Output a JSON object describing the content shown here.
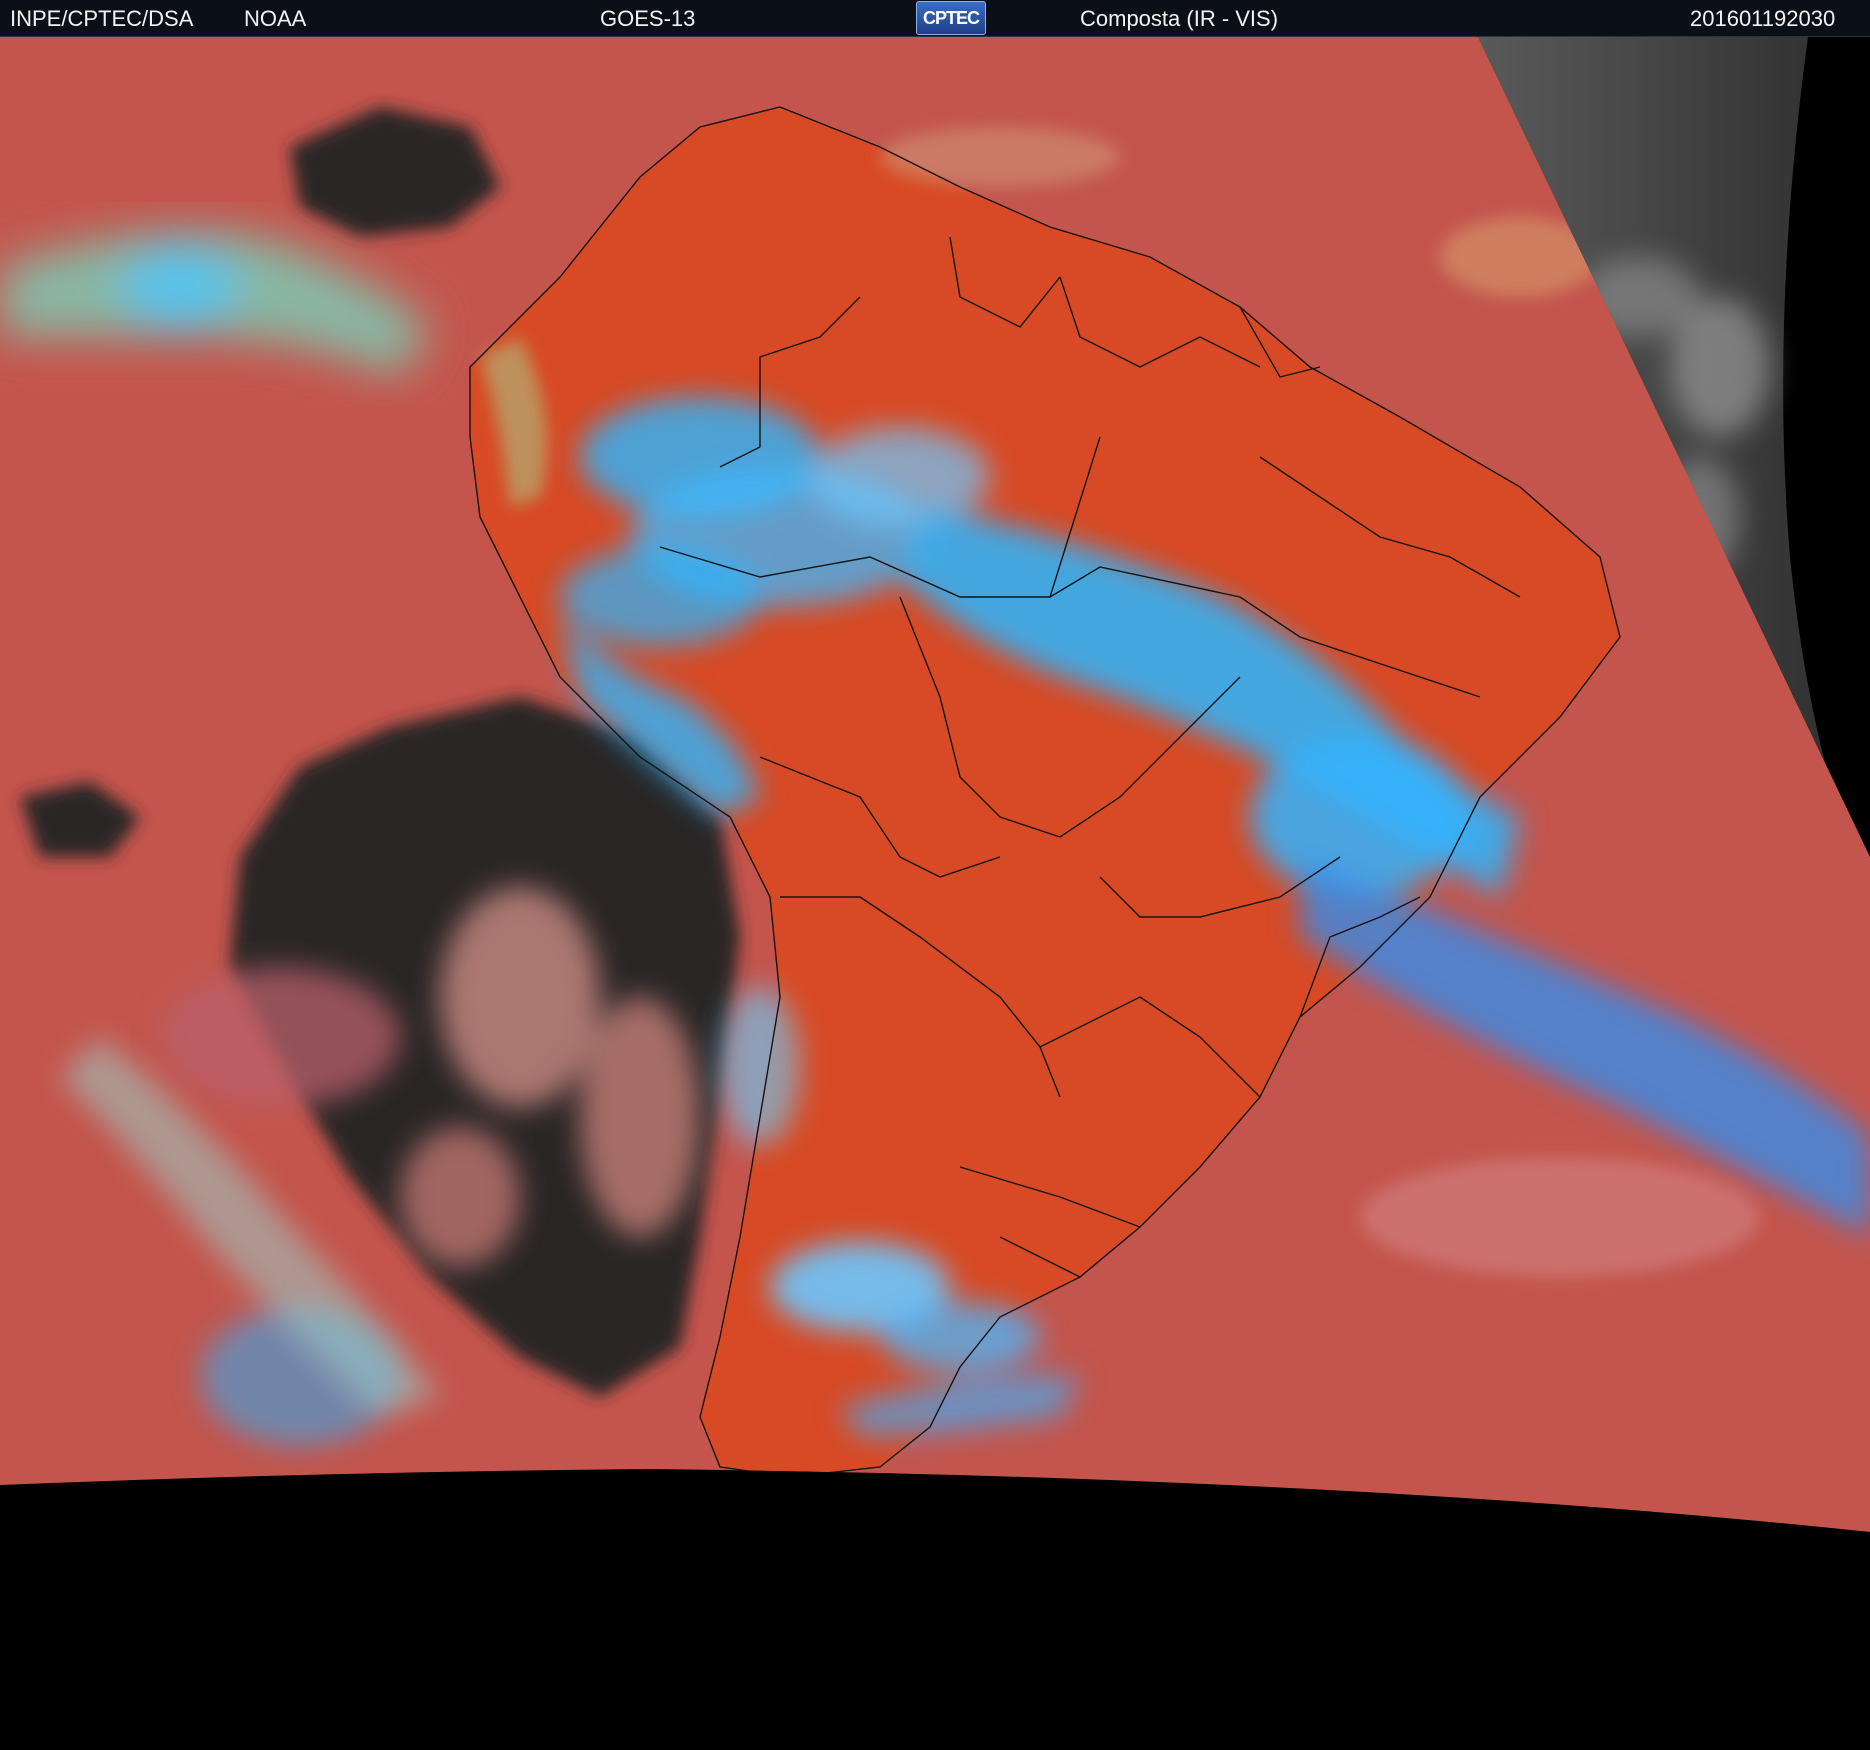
{
  "header": {
    "agency": "INPE/CPTEC/DSA",
    "source": "NOAA",
    "satellite": "GOES-13",
    "logo_text": "CPTEC",
    "product": "Composta (IR - VIS)",
    "timestamp": "201601192030"
  },
  "colors": {
    "background": "#000000",
    "clear_sky": "#c9544a",
    "land_clear": "#e0461f",
    "high_cloud": "#2ab6ff",
    "mid_cloud": "#8fd0c8",
    "night_side": "#4a4a4a",
    "cold_ocean_gap": "#1e1e1e",
    "borders": "#151515"
  }
}
